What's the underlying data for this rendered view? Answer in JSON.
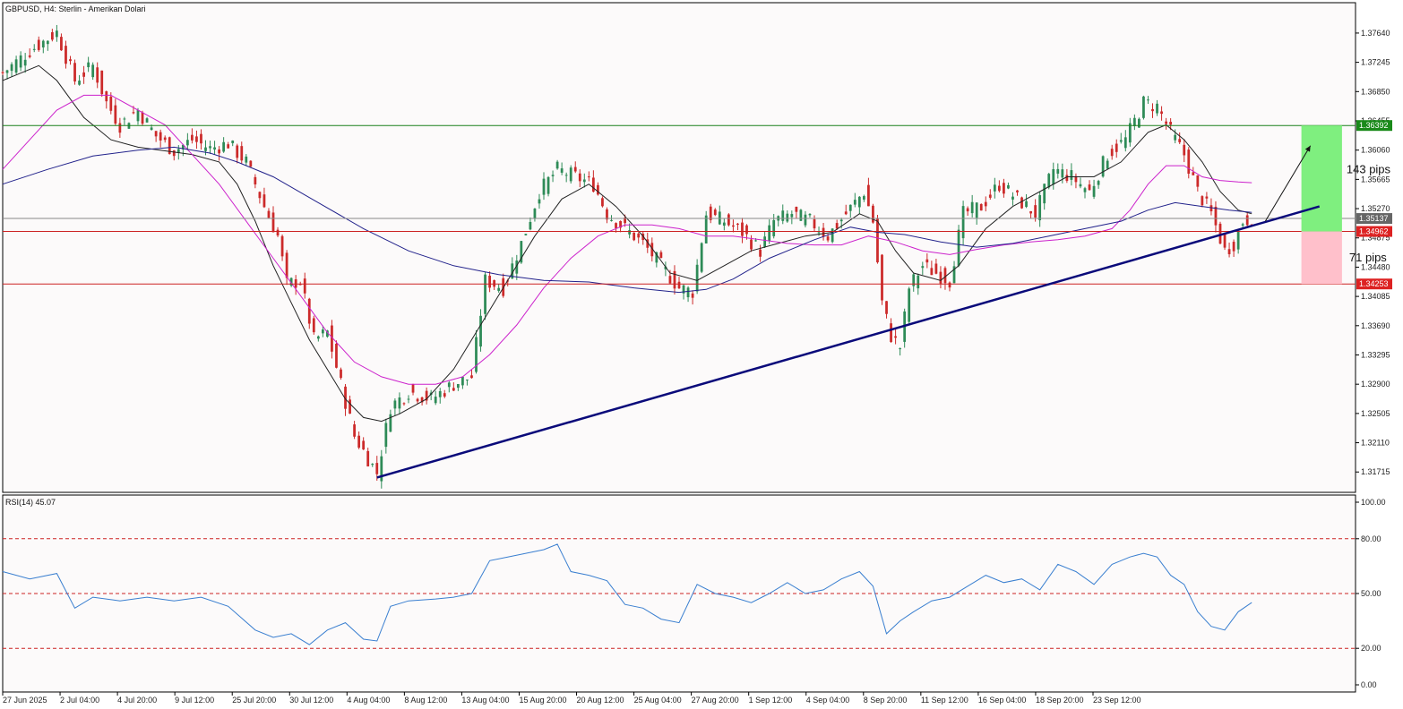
{
  "header": {
    "main_label": "GBPUSD, H4:  Sterlin - Amerikan Dolari",
    "rsi_label": "RSI(14) 45.07"
  },
  "colors": {
    "panel_bg": "#fcfafa",
    "grid_border": "#000000",
    "bull": "#2e8b57",
    "bear": "#cc2a2a",
    "ma_fast": "#222222",
    "ma_mid": "#cc22cc",
    "ma_slow": "#22228b",
    "trendline": "#0a0a7a",
    "resistance": "#1a7f1a",
    "support": "#cc2222",
    "gray_level": "#888888",
    "rsi_line": "#3a7fd0",
    "target_zone": "#7fef7f",
    "stop_zone": "#ffc0cb"
  },
  "chart_data": {
    "type": "candlestick",
    "symbol": "GBPUSD",
    "timeframe": "H4",
    "price_axis": {
      "ticks": [
        "1.37640",
        "1.37245",
        "1.36850",
        "1.36455",
        "1.36060",
        "1.35665",
        "1.35270",
        "1.34875",
        "1.34480",
        "1.34085",
        "1.33690",
        "1.33295",
        "1.32900",
        "1.32505",
        "1.32110",
        "1.31715"
      ],
      "range": [
        1.3144,
        1.3805
      ]
    },
    "time_axis": {
      "labels": [
        "27 Jun 2025",
        "2 Jul 04:00",
        "4 Jul 20:00",
        "9 Jul 12:00",
        "25 Jul 20:00",
        "30 Jul 12:00",
        "4 Aug 04:00",
        "8 Aug 12:00",
        "13 Aug 04:00",
        "15 Aug 20:00",
        "20 Aug 12:00",
        "25 Aug 04:00",
        "27 Aug 20:00",
        "1 Sep 12:00",
        "4 Sep 04:00",
        "8 Sep 20:00",
        "11 Sep 12:00",
        "16 Sep 04:00",
        "18 Sep 20:00",
        "23 Sep 12:00"
      ]
    },
    "price_path": [
      [
        0,
        1.371
      ],
      [
        6,
        1.374
      ],
      [
        12,
        1.3765
      ],
      [
        16,
        1.37
      ],
      [
        20,
        1.372
      ],
      [
        23,
        1.367
      ],
      [
        26,
        1.364
      ],
      [
        30,
        1.366
      ],
      [
        34,
        1.3625
      ],
      [
        38,
        1.3605
      ],
      [
        42,
        1.362
      ],
      [
        46,
        1.3608
      ],
      [
        50,
        1.3615
      ],
      [
        54,
        1.359
      ],
      [
        58,
        1.353
      ],
      [
        61,
        1.349
      ],
      [
        63,
        1.3425
      ],
      [
        66,
        1.343
      ],
      [
        69,
        1.335
      ],
      [
        72,
        1.336
      ],
      [
        75,
        1.329
      ],
      [
        78,
        1.322
      ],
      [
        81,
        1.319
      ],
      [
        83,
        1.317
      ],
      [
        86,
        1.326
      ],
      [
        90,
        1.328
      ],
      [
        95,
        1.327
      ],
      [
        100,
        1.329
      ],
      [
        104,
        1.33
      ],
      [
        107,
        1.343
      ],
      [
        111,
        1.342
      ],
      [
        115,
        1.348
      ],
      [
        119,
        1.355
      ],
      [
        123,
        1.358
      ],
      [
        127,
        1.357
      ],
      [
        131,
        1.356
      ],
      [
        134,
        1.352
      ],
      [
        138,
        1.35
      ],
      [
        142,
        1.348
      ],
      [
        146,
        1.345
      ],
      [
        150,
        1.342
      ],
      [
        153,
        1.3415
      ],
      [
        156,
        1.352
      ],
      [
        160,
        1.351
      ],
      [
        164,
        1.3495
      ],
      [
        168,
        1.347
      ],
      [
        171,
        1.351
      ],
      [
        175,
        1.352
      ],
      [
        179,
        1.351
      ],
      [
        183,
        1.349
      ],
      [
        187,
        1.352
      ],
      [
        191,
        1.355
      ],
      [
        193,
        1.351
      ],
      [
        195,
        1.34
      ],
      [
        197,
        1.3355
      ],
      [
        199,
        1.334
      ],
      [
        201,
        1.342
      ],
      [
        204,
        1.345
      ],
      [
        207,
        1.344
      ],
      [
        210,
        1.343
      ],
      [
        213,
        1.352
      ],
      [
        217,
        1.353
      ],
      [
        221,
        1.356
      ],
      [
        225,
        1.354
      ],
      [
        229,
        1.352
      ],
      [
        233,
        1.358
      ],
      [
        237,
        1.357
      ],
      [
        241,
        1.355
      ],
      [
        245,
        1.36
      ],
      [
        249,
        1.362
      ],
      [
        253,
        1.367
      ],
      [
        256,
        1.3665
      ],
      [
        259,
        1.363
      ],
      [
        262,
        1.36
      ],
      [
        265,
        1.355
      ],
      [
        268,
        1.352
      ],
      [
        271,
        1.347
      ],
      [
        273,
        1.348
      ],
      [
        275,
        1.351
      ],
      [
        277,
        1.3515
      ]
    ],
    "rsi": {
      "period": 14,
      "value": 45.07,
      "levels": [
        80,
        50,
        20
      ],
      "axis_ticks": [
        "100.00",
        "80.00",
        "50.00",
        "20.00",
        "0.00"
      ],
      "range": [
        0,
        100
      ],
      "path": [
        [
          0,
          62
        ],
        [
          6,
          58
        ],
        [
          12,
          61
        ],
        [
          16,
          42
        ],
        [
          20,
          48
        ],
        [
          26,
          46
        ],
        [
          32,
          48
        ],
        [
          38,
          46
        ],
        [
          44,
          48
        ],
        [
          50,
          43
        ],
        [
          56,
          30
        ],
        [
          60,
          26
        ],
        [
          64,
          28
        ],
        [
          68,
          22
        ],
        [
          72,
          30
        ],
        [
          76,
          34
        ],
        [
          80,
          25
        ],
        [
          83,
          24
        ],
        [
          86,
          43
        ],
        [
          90,
          46
        ],
        [
          96,
          47
        ],
        [
          100,
          48
        ],
        [
          104,
          50
        ],
        [
          108,
          68
        ],
        [
          112,
          70
        ],
        [
          116,
          72
        ],
        [
          120,
          74
        ],
        [
          123,
          77
        ],
        [
          126,
          62
        ],
        [
          130,
          60
        ],
        [
          134,
          57
        ],
        [
          138,
          44
        ],
        [
          142,
          42
        ],
        [
          146,
          36
        ],
        [
          150,
          34
        ],
        [
          154,
          55
        ],
        [
          158,
          50
        ],
        [
          162,
          48
        ],
        [
          166,
          45
        ],
        [
          170,
          50
        ],
        [
          174,
          56
        ],
        [
          178,
          50
        ],
        [
          182,
          52
        ],
        [
          186,
          58
        ],
        [
          190,
          62
        ],
        [
          193,
          54
        ],
        [
          196,
          28
        ],
        [
          199,
          35
        ],
        [
          202,
          40
        ],
        [
          206,
          46
        ],
        [
          210,
          48
        ],
        [
          214,
          54
        ],
        [
          218,
          60
        ],
        [
          222,
          56
        ],
        [
          226,
          58
        ],
        [
          230,
          52
        ],
        [
          234,
          66
        ],
        [
          238,
          62
        ],
        [
          242,
          55
        ],
        [
          246,
          66
        ],
        [
          250,
          70
        ],
        [
          253,
          72
        ],
        [
          256,
          70
        ],
        [
          259,
          60
        ],
        [
          262,
          55
        ],
        [
          265,
          40
        ],
        [
          268,
          32
        ],
        [
          271,
          30
        ],
        [
          274,
          40
        ],
        [
          277,
          45.07
        ]
      ]
    },
    "moving_averages": [
      {
        "path": [
          [
            0,
            1.37
          ],
          [
            8,
            1.372
          ],
          [
            12,
            1.37
          ],
          [
            18,
            1.365
          ],
          [
            24,
            1.362
          ],
          [
            30,
            1.361
          ],
          [
            36,
            1.3605
          ],
          [
            42,
            1.36
          ],
          [
            48,
            1.359
          ],
          [
            52,
            1.356
          ],
          [
            56,
            1.351
          ],
          [
            60,
            1.345
          ],
          [
            64,
            1.34
          ],
          [
            68,
            1.335
          ],
          [
            72,
            1.331
          ],
          [
            76,
            1.327
          ],
          [
            80,
            1.3245
          ],
          [
            84,
            1.324
          ],
          [
            88,
            1.325
          ],
          [
            94,
            1.327
          ],
          [
            100,
            1.331
          ],
          [
            106,
            1.337
          ],
          [
            112,
            1.343
          ],
          [
            118,
            1.349
          ],
          [
            124,
            1.354
          ],
          [
            130,
            1.356
          ],
          [
            136,
            1.353
          ],
          [
            142,
            1.349
          ],
          [
            148,
            1.344
          ],
          [
            154,
            1.343
          ],
          [
            160,
            1.345
          ],
          [
            166,
            1.347
          ],
          [
            172,
            1.348
          ],
          [
            178,
            1.349
          ],
          [
            184,
            1.3495
          ],
          [
            190,
            1.352
          ],
          [
            194,
            1.351
          ],
          [
            198,
            1.347
          ],
          [
            202,
            1.344
          ],
          [
            208,
            1.343
          ],
          [
            212,
            1.345
          ],
          [
            218,
            1.35
          ],
          [
            224,
            1.353
          ],
          [
            230,
            1.355
          ],
          [
            236,
            1.357
          ],
          [
            242,
            1.357
          ],
          [
            248,
            1.359
          ],
          [
            254,
            1.363
          ],
          [
            258,
            1.364
          ],
          [
            262,
            1.362
          ],
          [
            266,
            1.359
          ],
          [
            270,
            1.355
          ],
          [
            274,
            1.3525
          ],
          [
            277,
            1.352
          ]
        ]
      },
      {
        "path": [
          [
            0,
            1.358
          ],
          [
            6,
            1.362
          ],
          [
            12,
            1.366
          ],
          [
            18,
            1.368
          ],
          [
            24,
            1.368
          ],
          [
            30,
            1.366
          ],
          [
            36,
            1.364
          ],
          [
            42,
            1.36
          ],
          [
            48,
            1.356
          ],
          [
            54,
            1.351
          ],
          [
            60,
            1.346
          ],
          [
            66,
            1.341
          ],
          [
            72,
            1.336
          ],
          [
            78,
            1.332
          ],
          [
            84,
            1.33
          ],
          [
            90,
            1.329
          ],
          [
            96,
            1.329
          ],
          [
            102,
            1.33
          ],
          [
            108,
            1.333
          ],
          [
            114,
            1.337
          ],
          [
            120,
            1.342
          ],
          [
            126,
            1.346
          ],
          [
            132,
            1.349
          ],
          [
            138,
            1.3505
          ],
          [
            144,
            1.3505
          ],
          [
            150,
            1.35
          ],
          [
            156,
            1.349
          ],
          [
            162,
            1.349
          ],
          [
            168,
            1.3485
          ],
          [
            174,
            1.348
          ],
          [
            180,
            1.3478
          ],
          [
            186,
            1.3478
          ],
          [
            192,
            1.349
          ],
          [
            198,
            1.3482
          ],
          [
            204,
            1.347
          ],
          [
            210,
            1.3465
          ],
          [
            216,
            1.3472
          ],
          [
            222,
            1.3478
          ],
          [
            228,
            1.3482
          ],
          [
            234,
            1.3485
          ],
          [
            240,
            1.349
          ],
          [
            246,
            1.35
          ],
          [
            250,
            1.3525
          ],
          [
            254,
            1.356
          ],
          [
            258,
            1.3585
          ],
          [
            262,
            1.3585
          ],
          [
            266,
            1.357
          ],
          [
            270,
            1.3565
          ],
          [
            274,
            1.3563
          ],
          [
            277,
            1.3562
          ]
        ]
      },
      {
        "path": [
          [
            0,
            1.356
          ],
          [
            10,
            1.358
          ],
          [
            20,
            1.3598
          ],
          [
            30,
            1.3606
          ],
          [
            38,
            1.361
          ],
          [
            46,
            1.3602
          ],
          [
            52,
            1.359
          ],
          [
            60,
            1.357
          ],
          [
            70,
            1.3535
          ],
          [
            80,
            1.35
          ],
          [
            90,
            1.347
          ],
          [
            100,
            1.345
          ],
          [
            110,
            1.3438
          ],
          [
            120,
            1.343
          ],
          [
            130,
            1.3428
          ],
          [
            140,
            1.342
          ],
          [
            150,
            1.3414
          ],
          [
            156,
            1.3418
          ],
          [
            162,
            1.3432
          ],
          [
            170,
            1.346
          ],
          [
            180,
            1.3485
          ],
          [
            188,
            1.3502
          ],
          [
            194,
            1.3495
          ],
          [
            200,
            1.3492
          ],
          [
            208,
            1.3482
          ],
          [
            216,
            1.3475
          ],
          [
            224,
            1.348
          ],
          [
            232,
            1.349
          ],
          [
            240,
            1.35
          ],
          [
            248,
            1.351
          ],
          [
            254,
            1.3525
          ],
          [
            260,
            1.3535
          ],
          [
            266,
            1.353
          ],
          [
            272,
            1.3525
          ],
          [
            277,
            1.3522
          ]
        ]
      }
    ],
    "levels": {
      "resistance": {
        "value": 1.36392,
        "label": "1.36392"
      },
      "current": {
        "value": 1.35137,
        "label": "1.35137"
      },
      "entry": {
        "value": 1.34962,
        "label": "1.34962"
      },
      "support": {
        "value": 1.34253,
        "label": "1.34253"
      }
    },
    "trendline": {
      "from": [
        83,
        1.3164
      ],
      "to": [
        292,
        1.353
      ]
    },
    "projection_arrow": {
      "from": [
        280,
        1.351
      ],
      "to": [
        290,
        1.3612
      ]
    },
    "annotations": [
      {
        "text": "143 pips",
        "zone": "target",
        "from": 1.36392,
        "to": 1.34962
      },
      {
        "text": "71 pips",
        "zone": "stop",
        "from": 1.34962,
        "to": 1.34253
      }
    ],
    "zones_x": [
      288,
      297
    ]
  }
}
